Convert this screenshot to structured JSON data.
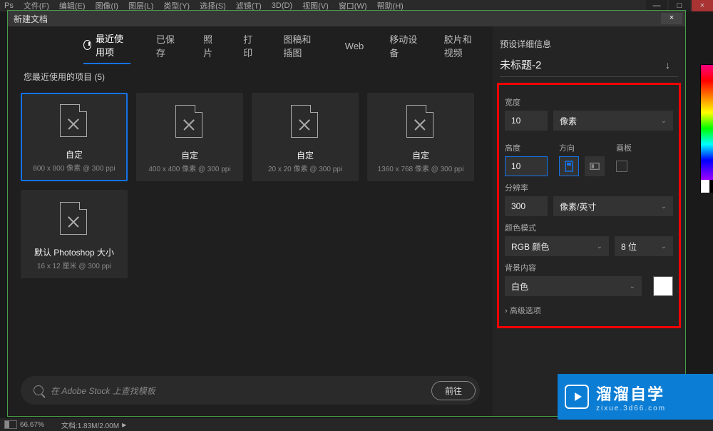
{
  "menuBar": {
    "items": [
      "文件(F)",
      "编辑(E)",
      "图像(I)",
      "图层(L)",
      "类型(Y)",
      "选择(S)",
      "滤镜(T)",
      "3D(D)",
      "视图(V)",
      "窗口(W)",
      "帮助(H)"
    ]
  },
  "dialog": {
    "title": "新建文档",
    "tabs": {
      "recent": "最近使用项",
      "saved": "已保存",
      "photo": "照片",
      "print": "打印",
      "art": "图稿和插图",
      "web": "Web",
      "mobile": "移动设备",
      "film": "胶片和视频"
    },
    "recentLabel": "您最近使用的项目",
    "recentCount": "(5)",
    "presets": [
      {
        "title": "自定",
        "sub": "800 x 800 像素 @ 300 ppi"
      },
      {
        "title": "自定",
        "sub": "400 x 400 像素 @ 300 ppi"
      },
      {
        "title": "自定",
        "sub": "20 x 20 像素 @ 300 ppi"
      },
      {
        "title": "自定",
        "sub": "1360 x 768 像素 @ 300 ppi"
      },
      {
        "title": "默认 Photoshop 大小",
        "sub": "16 x 12 厘米 @ 300 ppi"
      }
    ],
    "stock": {
      "placeholder": "在 Adobe Stock 上查找模板",
      "goBtn": "前往"
    },
    "details": {
      "heading": "预设详细信息",
      "docName": "未标题-2",
      "widthLabel": "宽度",
      "widthValue": "10",
      "widthUnit": "像素",
      "heightLabel": "高度",
      "heightValue": "10",
      "orientLabel": "方向",
      "artboardLabel": "画板",
      "resLabel": "分辨率",
      "resValue": "300",
      "resUnit": "像素/英寸",
      "colorModeLabel": "颜色模式",
      "colorMode": "RGB 颜色",
      "bitDepth": "8 位",
      "bgLabel": "背景内容",
      "bgValue": "白色",
      "advanced": "高级选项"
    }
  },
  "watermark": {
    "brand": "溜溜自学",
    "url": "zixue.3d66.com"
  },
  "status": {
    "zoom": "66.67%",
    "doc": "文档:1.83M/2.00M"
  }
}
